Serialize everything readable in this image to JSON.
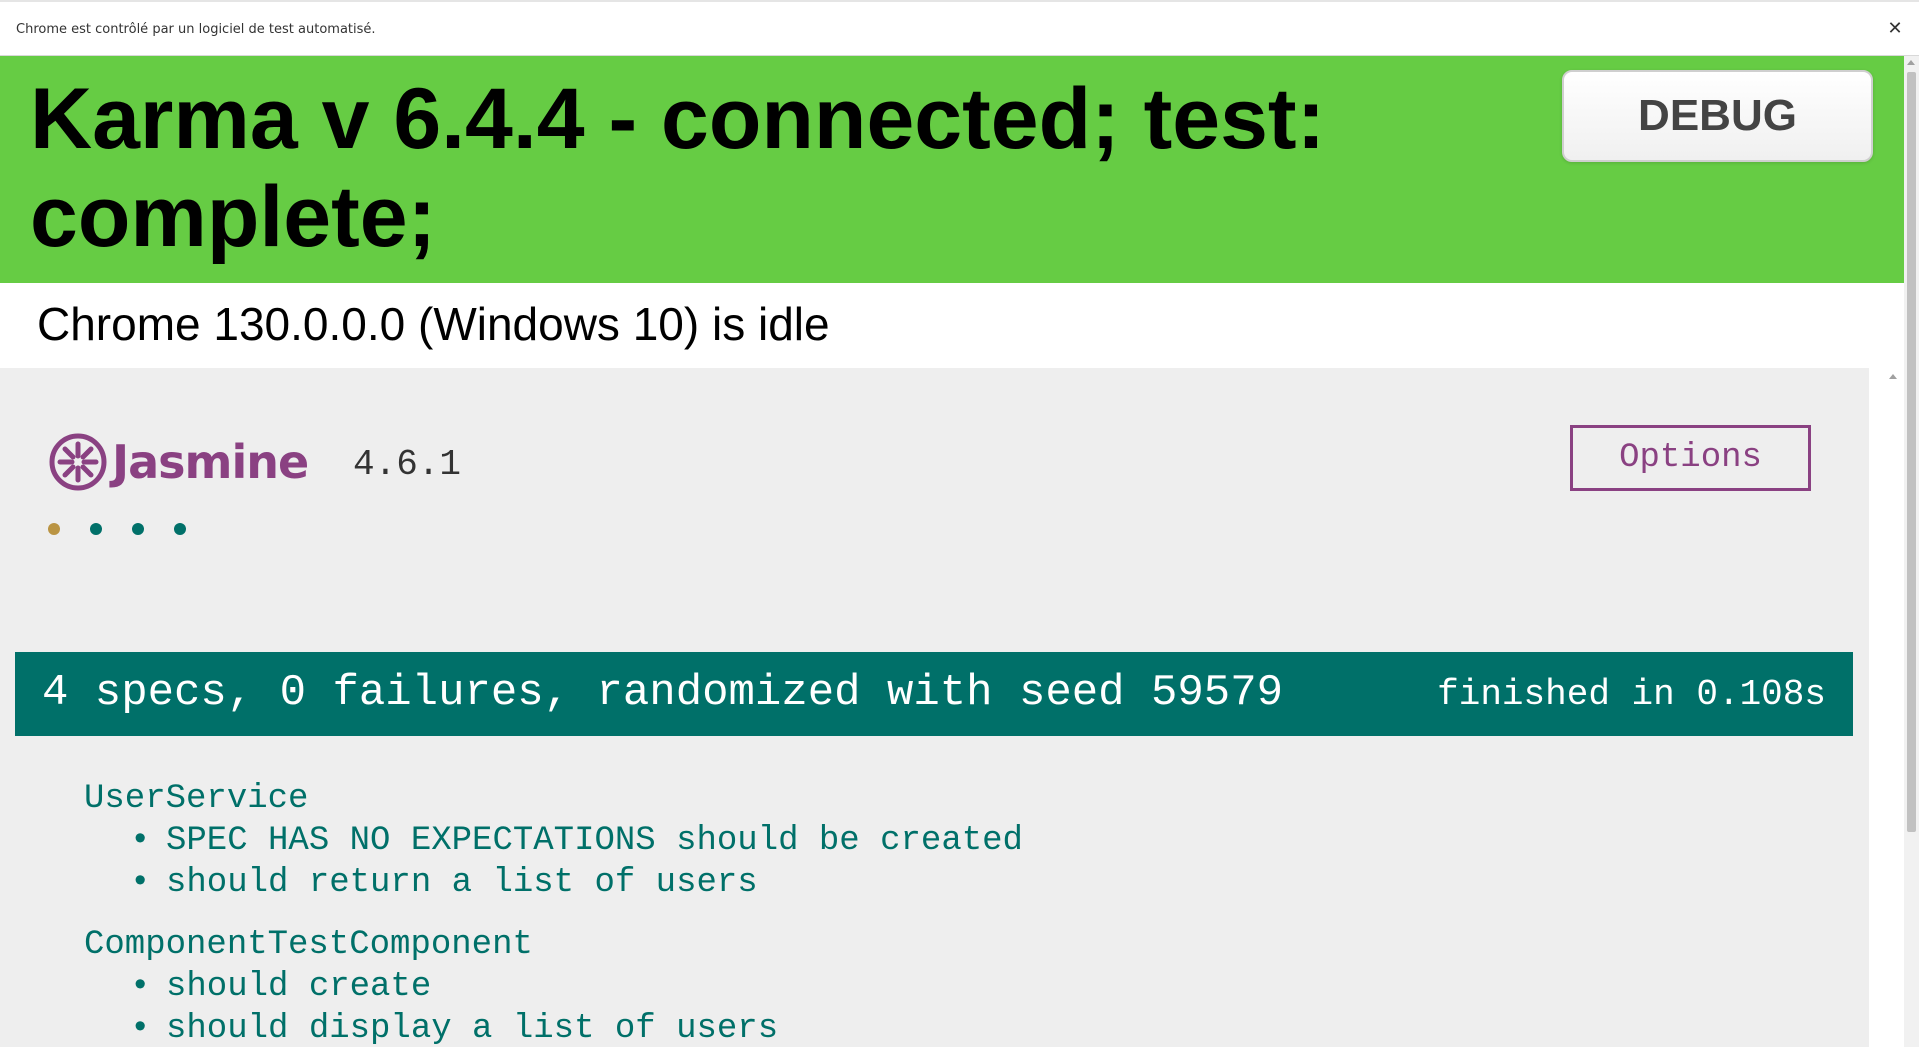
{
  "infobar": {
    "message": "Chrome est contrôlé par un logiciel de test automatisé.",
    "close_glyph": "✕"
  },
  "karma": {
    "status_title": "Karma v 6.4.4 - connected; test: complete;",
    "debug_label": "DEBUG",
    "browser_status": "Chrome 130.0.0.0 (Windows 10) is idle",
    "banner_color": "#66cc44"
  },
  "jasmine": {
    "logo_text": "Jasmine",
    "version": "4.6.1",
    "options_label": "Options",
    "brand_color": "#8a4182",
    "spec_dots": [
      {
        "status": "pending",
        "color": "#ba9443"
      },
      {
        "status": "passed",
        "color": "#007069"
      },
      {
        "status": "passed",
        "color": "#007069"
      },
      {
        "status": "passed",
        "color": "#007069"
      }
    ],
    "summary": {
      "text": "4 specs, 0 failures, randomized with seed 59579",
      "duration": "finished in 0.108s",
      "color": "#007069"
    },
    "suites": [
      {
        "name": "UserService",
        "specs": [
          "SPEC HAS NO EXPECTATIONS should be created",
          "should return a list of users"
        ]
      },
      {
        "name": "ComponentTestComponent",
        "specs": [
          "should create",
          "should display a list of users"
        ]
      }
    ]
  }
}
